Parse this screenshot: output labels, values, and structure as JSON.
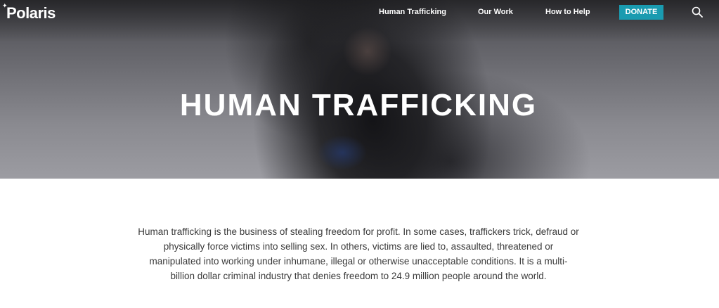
{
  "header": {
    "logo_text": "Polaris",
    "nav": [
      {
        "label": "Human Trafficking"
      },
      {
        "label": "Our Work"
      },
      {
        "label": "How to Help"
      }
    ],
    "donate_label": "DONATE",
    "search_icon": "search-icon"
  },
  "hero": {
    "title": "HUMAN TRAFFICKING"
  },
  "main": {
    "intro": "Human trafficking is the business of stealing freedom for profit. In some cases, traffickers trick, defraud or physically force victims into selling sex. In others, victims are lied to, assaulted, threatened or manipulated into working under inhumane, illegal or otherwise unacceptable conditions. It is a multi-billion dollar criminal industry that denies freedom to 24.9 million people around the world."
  },
  "colors": {
    "accent": "#1a9bb0"
  }
}
